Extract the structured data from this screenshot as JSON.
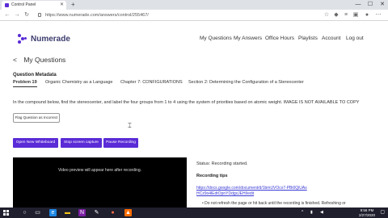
{
  "browser": {
    "tab_title": "Control Panel",
    "new_tab_glyph": "+",
    "url": "https://www.numerade.com/answers/control/255467/",
    "window_controls": [
      "—",
      "☐",
      "✕"
    ]
  },
  "header": {
    "logo_text": "Numerade",
    "nav": [
      "My Questions",
      "My Answers",
      "Office Hours",
      "Playlists",
      "Account",
      "Log out"
    ]
  },
  "page": {
    "title": "My Questions",
    "metadata_title": "Question Metadata",
    "metadata": {
      "problem": "Problem 19",
      "course": "Organic Chemistry as a Language",
      "chapter": "Chapter 7: CONFIGURATIONS",
      "section": "Section 2: Determining the Configuration of a Stereocenter"
    },
    "question_text": "In the compound below, find the stereocenter, and label the four groups from 1 to 4 using the system of priorities based on atomic weight. IMAGE IS NOT AVAILABLE TO COPY",
    "flag_button": "Flag Question as Incorrect",
    "buttons": {
      "whiteboard": "Open New Whiteboard",
      "stop_capture": "Stop screen capture",
      "pause_recording": "Pause Recording"
    },
    "video_placeholder": "Video preview will appear here after recording.",
    "status": "Status: Recording started.",
    "tips_title": "Recording tips",
    "tips_link": "https://docs.google.com/document/d/1bmUVOcx7-PBi0QiUAsHCz9o4lEdtOpnYDdgxJEHl/edit",
    "tips_bullet": "• Do not refresh the page or hit back until the recording is finished. Refreshing or"
  },
  "taskbar": {
    "time": "9:56 PM",
    "date": "2/27/2020"
  },
  "colors": {
    "accent": "#5a2bd6",
    "taskbar": "#1f1f2e"
  }
}
